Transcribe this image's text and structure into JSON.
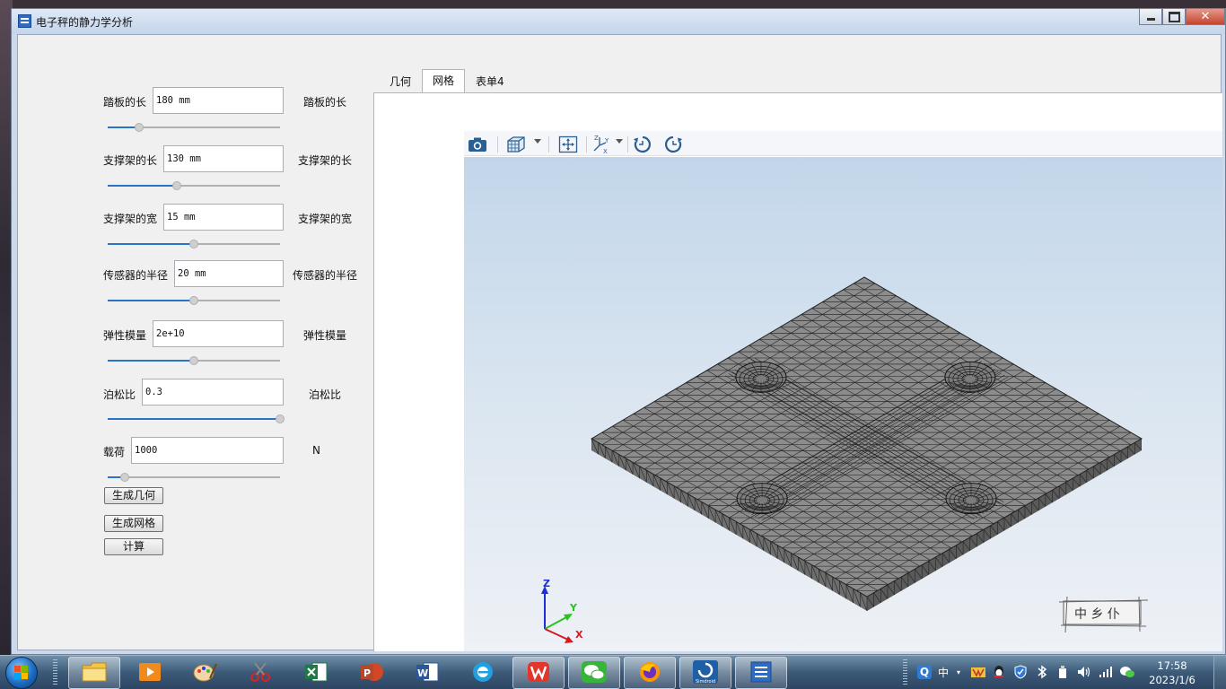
{
  "window": {
    "title": "电子秤的静力学分析"
  },
  "params": [
    {
      "label": "踏板的长",
      "value": "180 mm",
      "unit": "踏板的长",
      "slider": 0.18
    },
    {
      "label": "支撑架的长",
      "value": "130 mm",
      "unit": "支撑架的长",
      "slider": 0.4
    },
    {
      "label": "支撑架的宽",
      "value": "15 mm",
      "unit": "支撑架的宽",
      "slider": 0.5
    },
    {
      "label": "传感器的半径",
      "value": "20 mm",
      "unit": "传感器的半径",
      "slider": 0.5
    },
    {
      "label": "弹性模量",
      "value": "2e+10",
      "unit": "弹性模量",
      "slider": 0.5
    },
    {
      "label": "泊松比",
      "value": "0.3",
      "unit": "泊松比",
      "slider": 1.0
    },
    {
      "label": "载荷",
      "value": "1000",
      "unit": "N",
      "slider": 0.1
    }
  ],
  "buttons": {
    "geometry": "生成几何",
    "mesh": "生成网格",
    "compute": "计算"
  },
  "tabs": [
    {
      "label": "几何",
      "active": false
    },
    {
      "label": "网格",
      "active": true
    },
    {
      "label": "表单4",
      "active": false
    }
  ],
  "viewer": {
    "toolbar": [
      "camera-icon",
      "view-cube-icon",
      "fit-view-icon",
      "axis-orient-icon",
      "rotate-ccw-icon",
      "rotate-cw-icon"
    ],
    "triad": {
      "z": "Z",
      "y": "Y",
      "x": "X"
    },
    "logo_text": "中 乡 仆",
    "model_color": "#8c8c8c",
    "mesh_line_color": "#1e1e1e"
  },
  "taskbar": {
    "apps": [
      "file-explorer-icon",
      "media-player-icon",
      "paint-icon",
      "snipping-tool-icon",
      "excel-icon",
      "powerpoint-icon",
      "word-icon",
      "edge-icon",
      "wps-icon",
      "wechat-icon",
      "firefox-icon",
      "simdroid-icon",
      "app-window-icon"
    ],
    "active_apps": [
      "file-explorer-icon",
      "wps-icon",
      "wechat-icon",
      "firefox-icon",
      "simdroid-icon",
      "app-window-icon"
    ],
    "tray": {
      "ime_lang": "中"
    },
    "clock": {
      "time": "17:58",
      "date": "2023/1/6"
    }
  }
}
